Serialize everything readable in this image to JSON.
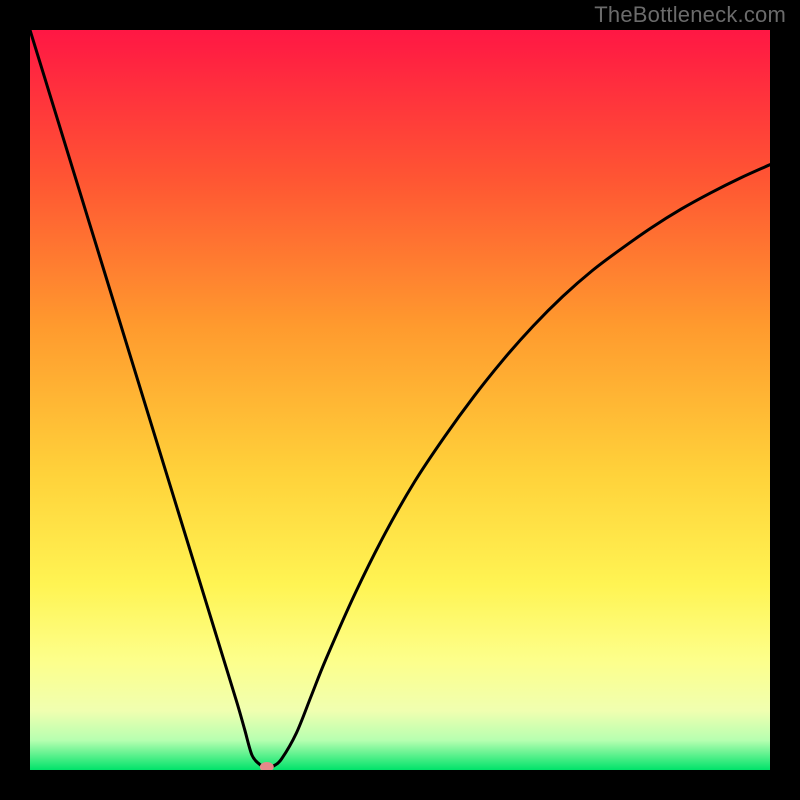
{
  "watermark": "TheBottleneck.com",
  "chart_data": {
    "type": "line",
    "title": "",
    "xlabel": "",
    "ylabel": "",
    "xlim": [
      0,
      100
    ],
    "ylim": [
      0,
      100
    ],
    "x": [
      0,
      2,
      4,
      6,
      8,
      10,
      12,
      14,
      16,
      18,
      20,
      22,
      24,
      26,
      28,
      29,
      30,
      31,
      32,
      33,
      34,
      36,
      38,
      40,
      44,
      48,
      52,
      56,
      60,
      64,
      68,
      72,
      76,
      80,
      84,
      88,
      92,
      96,
      100
    ],
    "values": [
      100,
      93.5,
      87,
      80.5,
      74,
      67.5,
      61,
      54.5,
      48,
      41.5,
      35,
      28.5,
      22,
      15.5,
      9,
      5.5,
      2,
      0.8,
      0.2,
      0.6,
      1.5,
      5,
      10,
      15,
      24,
      32,
      39,
      45,
      50.5,
      55.5,
      60,
      64,
      67.5,
      70.5,
      73.3,
      75.8,
      78,
      80,
      81.8
    ],
    "marker": {
      "x": 32,
      "y": 0,
      "color": "#e48a8a"
    },
    "gradient_stops": [
      {
        "offset": 0.0,
        "color": "#ff1744"
      },
      {
        "offset": 0.2,
        "color": "#ff5533"
      },
      {
        "offset": 0.4,
        "color": "#ff9a2e"
      },
      {
        "offset": 0.6,
        "color": "#ffd23a"
      },
      {
        "offset": 0.75,
        "color": "#fff453"
      },
      {
        "offset": 0.85,
        "color": "#fdff8a"
      },
      {
        "offset": 0.92,
        "color": "#f0ffb0"
      },
      {
        "offset": 0.96,
        "color": "#b6ffb0"
      },
      {
        "offset": 1.0,
        "color": "#00e36a"
      }
    ]
  }
}
